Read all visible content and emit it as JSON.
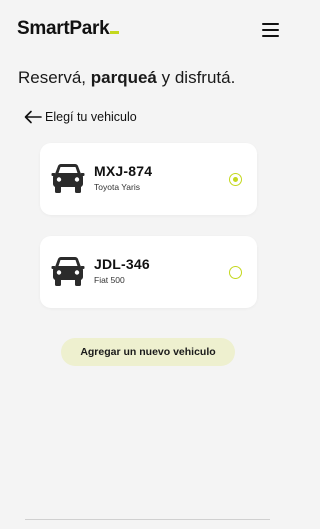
{
  "header": {
    "logo_text": "SmartPark",
    "menu_icon": "hamburger-menu-icon"
  },
  "tagline": {
    "part1": "Reservá, ",
    "part2": "parqueá",
    "part3": " y disfrutá."
  },
  "back": {
    "icon": "arrow-left-icon",
    "label": "Elegí tu vehiculo"
  },
  "vehicles": [
    {
      "plate": "MXJ-874",
      "model": "Toyota Yaris",
      "selected": true,
      "icon": "car-icon"
    },
    {
      "plate": "JDL-346",
      "model": "Fiat 500",
      "selected": false,
      "icon": "car-icon"
    }
  ],
  "add_button": {
    "label": "Agregar un nuevo vehiculo"
  },
  "colors": {
    "accent": "#c4d81e",
    "button_bg": "#eef0cf",
    "background": "#f4f4f4",
    "card_bg": "#ffffff"
  }
}
